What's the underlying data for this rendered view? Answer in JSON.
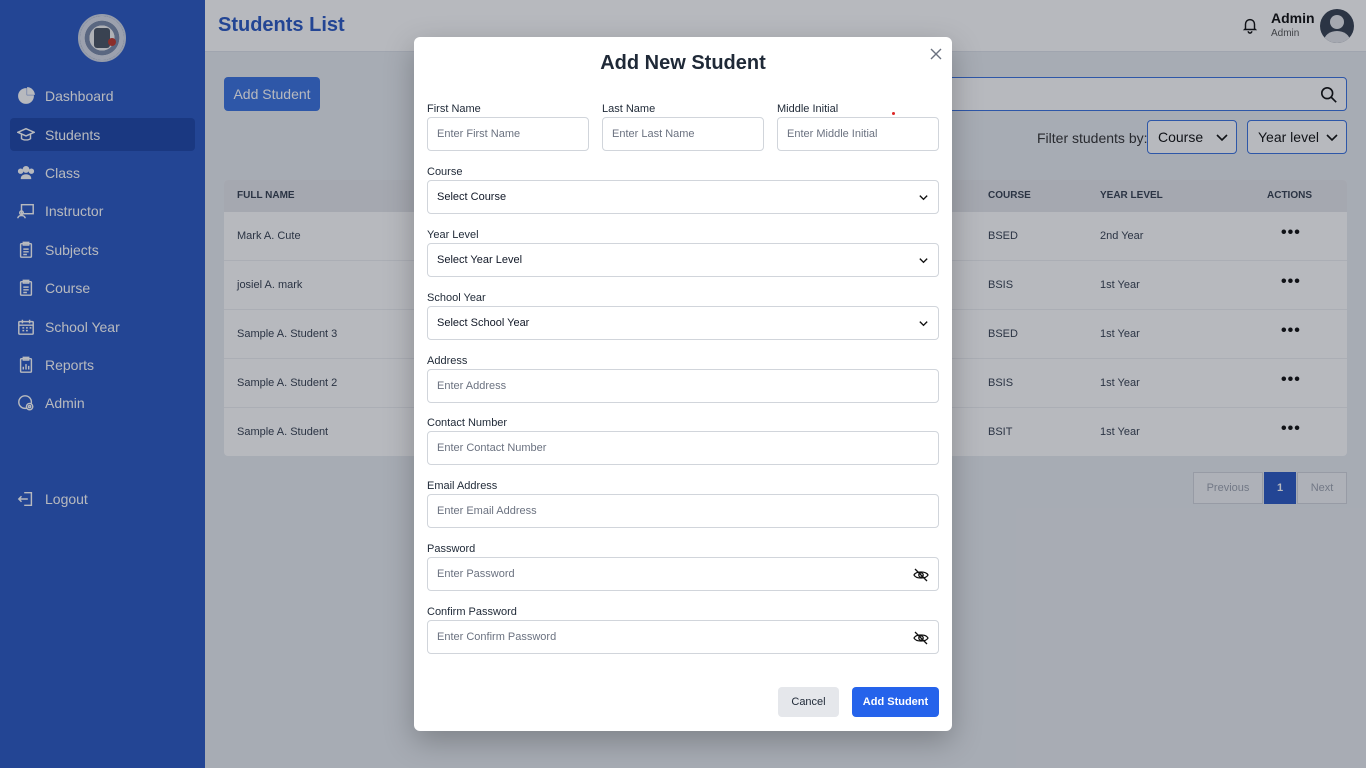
{
  "sidebar": {
    "items": [
      {
        "label": "Dashboard",
        "icon": "pie-chart-icon"
      },
      {
        "label": "Students",
        "icon": "graduation-cap-icon"
      },
      {
        "label": "Class",
        "icon": "users-icon"
      },
      {
        "label": "Instructor",
        "icon": "presentation-icon"
      },
      {
        "label": "Subjects",
        "icon": "clipboard-icon"
      },
      {
        "label": "Course",
        "icon": "clipboard-icon"
      },
      {
        "label": "School Year",
        "icon": "calendar-icon"
      },
      {
        "label": "Reports",
        "icon": "report-icon"
      },
      {
        "label": "Admin",
        "icon": "user-gear-icon"
      }
    ],
    "logout_label": "Logout"
  },
  "header": {
    "title": "Students List",
    "user_name": "Admin",
    "user_role": "Admin"
  },
  "main": {
    "add_button": "Add Student",
    "filter_label": "Filter students by:",
    "filter_course": "Course",
    "filter_year": "Year level",
    "columns": {
      "full_name": "FULL NAME",
      "course": "COURSE",
      "year_level": "YEAR LEVEL",
      "actions": "ACTIONS"
    },
    "rows": [
      {
        "name": "Mark A. Cute",
        "course": "BSED",
        "year": "2nd Year"
      },
      {
        "name": "josiel A. mark",
        "course": "BSIS",
        "year": "1st Year"
      },
      {
        "name": "Sample A. Student 3",
        "course": "BSED",
        "year": "1st Year"
      },
      {
        "name": "Sample A. Student 2",
        "course": "BSIS",
        "year": "1st Year"
      },
      {
        "name": "Sample A. Student",
        "course": "BSIT",
        "year": "1st Year"
      }
    ],
    "actions_glyph": "•••",
    "pagination": {
      "previous": "Previous",
      "page": "1",
      "next": "Next"
    }
  },
  "modal": {
    "title": "Add New Student",
    "first_name": {
      "label": "First Name",
      "placeholder": "Enter First Name"
    },
    "last_name": {
      "label": "Last Name",
      "placeholder": "Enter Last Name"
    },
    "middle_initial": {
      "label": "Middle Initial",
      "placeholder": "Enter Middle Initial"
    },
    "course": {
      "label": "Course",
      "value": "Select Course"
    },
    "year_level": {
      "label": "Year Level",
      "value": "Select Year Level"
    },
    "school_year": {
      "label": "School Year",
      "value": "Select School Year"
    },
    "address": {
      "label": "Address",
      "placeholder": "Enter Address"
    },
    "contact": {
      "label": "Contact Number",
      "placeholder": "Enter Contact Number"
    },
    "email": {
      "label": "Email Address",
      "placeholder": "Enter Email Address"
    },
    "password": {
      "label": "Password",
      "placeholder": "Enter Password"
    },
    "confirm_password": {
      "label": "Confirm Password",
      "placeholder": "Enter Confirm Password"
    },
    "cancel_label": "Cancel",
    "submit_label": "Add Student"
  },
  "colors": {
    "sidebar": "#2b59c3",
    "accent": "#2563eb",
    "title": "#2b59c3"
  }
}
